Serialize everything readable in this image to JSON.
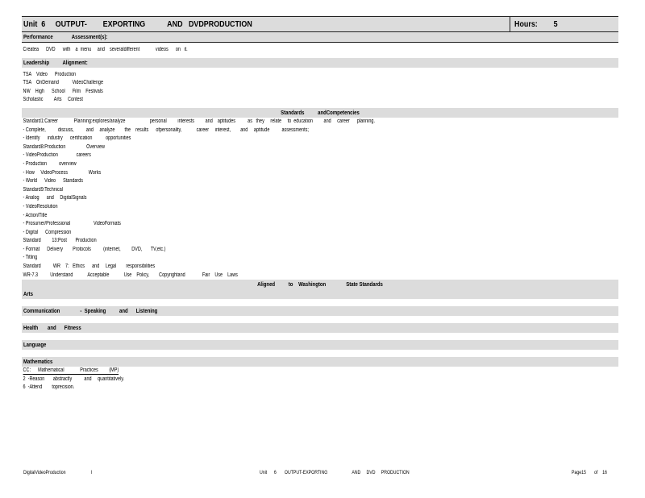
{
  "header": {
    "unit_title": "Unit  6     OUTPUT-        EXPORTING           AND   DVDPRODUCTION",
    "hours": "Hours:        5"
  },
  "performance": {
    "heading": "Performance              Assessment(s):",
    "text": "Createa      DVD      with    a  menu     and    severaldifferent             videos      on   it."
  },
  "leadership": {
    "heading": "Leadership          Alignment:",
    "lines": [
      "TSA    Video      Production",
      "TSA    OnDemand           VideoChallenge",
      "NW    High      School      Film    Festivals",
      "Scholastic         Arts     Contest"
    ]
  },
  "standards": {
    "heading": "Standards          andCompetencies",
    "lines": [
      "Standard1:Career             Planning:explores/analyze                    personal         interests         and    aptitudes          as   they     relate     to  education         and     career      planning.",
      "- Complete,          discuss,          and     analyze        the    results      ofpersonality,            career     interest,        and     aptitude          assessments;",
      "- Identify      industry      certification           opportunities",
      "Standard8:Production                 Overview",
      "- VideoProduction               careers",
      "- Production          overview",
      "- How     VideoProcess                 Works",
      "- World      Video      Standards",
      "Standard9:Technical",
      "- Analog      and     DigitalSignals",
      "- VideoResolution",
      "- Action/Title",
      "- Prosumer/Professional                   VideoFormats",
      "- Digital      Compression",
      "Standard         13:Post       Production",
      "- Format      Delivery        Protocols          (internet,         DVD,       TV,etc.)",
      "- Titling",
      "Standard          WR    7:   Ethics      and     Legal        responsibilities",
      "WR-7.3          Understand            Acceptable            Use    Policy,        Copyrightand              Fair    Use    Laws"
    ]
  },
  "aligned": {
    "heading": "Aligned          to    Washington               State Standards"
  },
  "subjects": {
    "arts": "Arts",
    "communication": "Communication               -  Speaking          and      Listening",
    "health": "Health       and      Fitness",
    "language": "Language",
    "mathematics": "Mathematics"
  },
  "math": {
    "cc_line": "CC:      Mathematical             Practices         (MP)",
    "lines": [
      "2  -Reason       abstractly          and     quantitatively.",
      "6  -Attend        toprecision."
    ]
  },
  "footer": {
    "left": "DigitalVideoProduction",
    "separator": "I",
    "center": "Unit      6       OUTPUT-EXPORTING                     AND     DVD     PRODUCTION",
    "right": "Page15       of    16"
  }
}
